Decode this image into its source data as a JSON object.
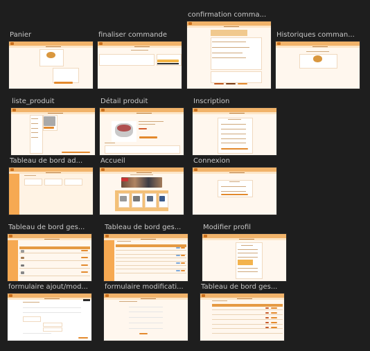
{
  "frames": [
    {
      "id": "panier",
      "label": "Panier"
    },
    {
      "id": "finaliser",
      "label": "finaliser commande"
    },
    {
      "id": "confirmation",
      "label": "confirmation comma..."
    },
    {
      "id": "historiques",
      "label": "Historiques comman..."
    },
    {
      "id": "liste",
      "label": "liste_produit"
    },
    {
      "id": "detail",
      "label": "Détail produit"
    },
    {
      "id": "inscription",
      "label": "Inscription"
    },
    {
      "id": "tbadmin",
      "label": "Tableau de bord ad..."
    },
    {
      "id": "accueil",
      "label": "Accueil"
    },
    {
      "id": "connexion",
      "label": "Connexion"
    },
    {
      "id": "tbges1",
      "label": "Tableau de bord ges..."
    },
    {
      "id": "tbges2",
      "label": "Tableau de bord ges..."
    },
    {
      "id": "modifprofil",
      "label": "Modifier profil"
    },
    {
      "id": "formajout",
      "label": "formulaire ajout/mod..."
    },
    {
      "id": "formmodif",
      "label": "formulaire modificati..."
    },
    {
      "id": "tbges3",
      "label": "Tableau de bord ges..."
    }
  ],
  "colors": {
    "canvas": "#1e1e1e",
    "label": "#c8c8c8",
    "page_bg": "#fff7ee",
    "header": "#f1b36a",
    "accent": "#e3892c",
    "sidebar": "#f6a952"
  }
}
